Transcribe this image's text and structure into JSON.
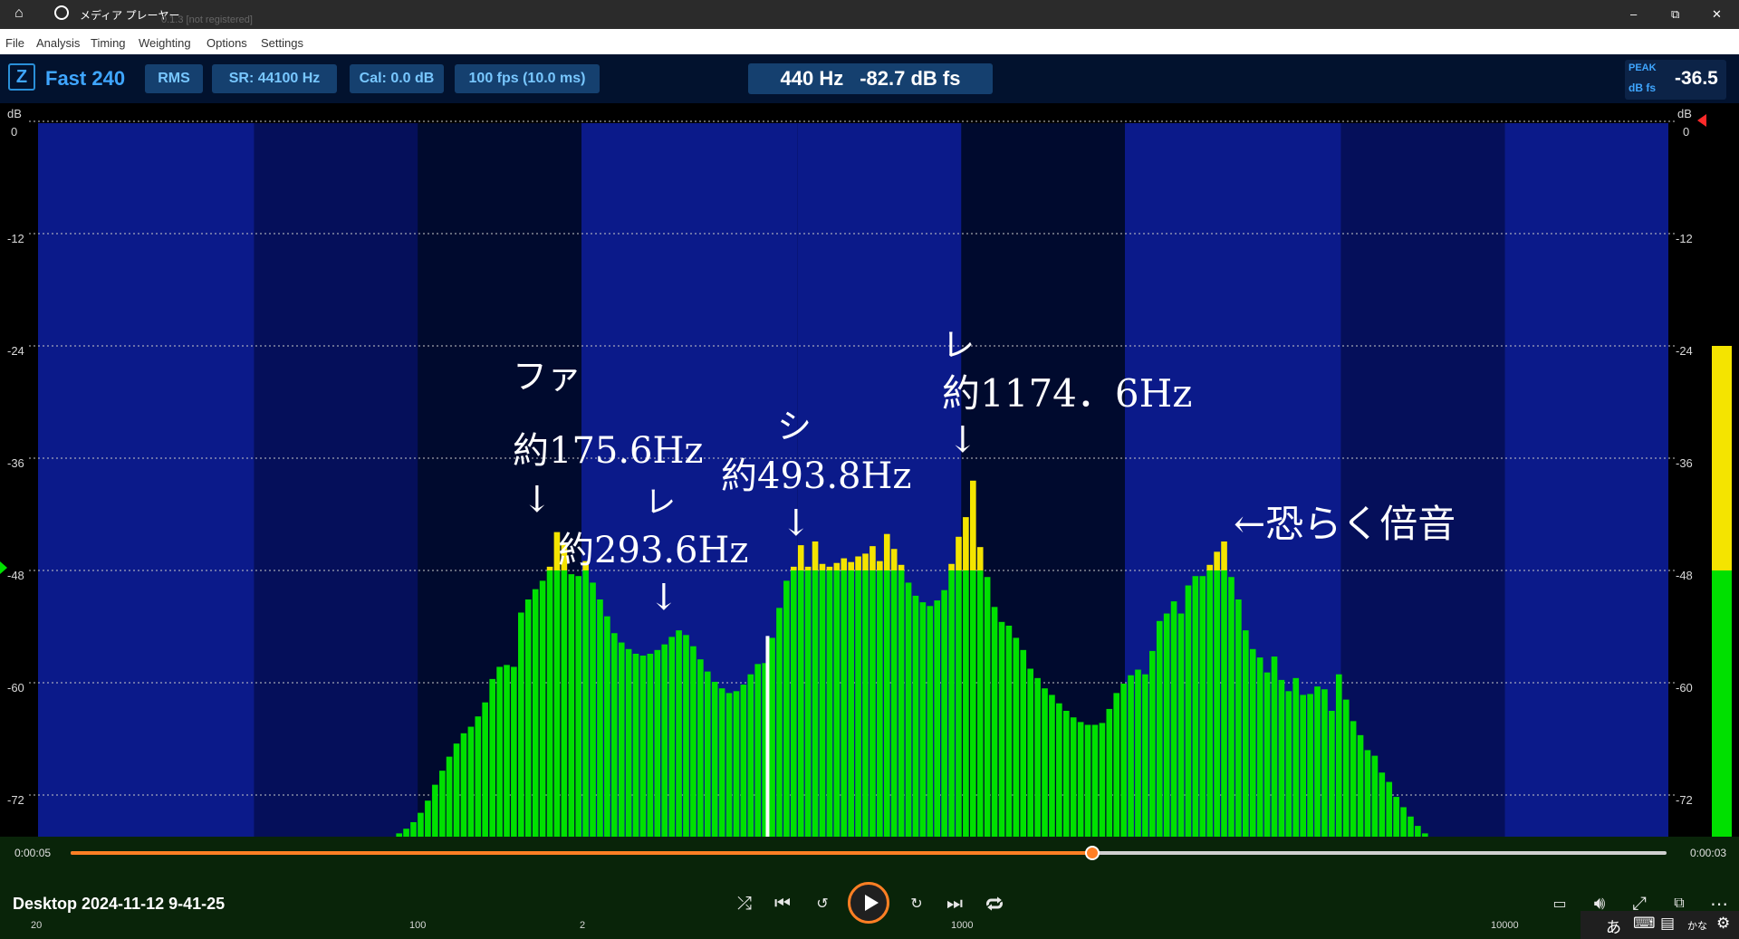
{
  "titlebar": {
    "title": "メディア プレーヤー",
    "behind_title": "0.1.3 [not registered]",
    "minimize": "–",
    "restore": "⧉",
    "close": "✕"
  },
  "menu": [
    "File",
    "Analysis",
    "Timing",
    "Weighting",
    "Options",
    "Settings"
  ],
  "toolbar": {
    "z_label": "Z",
    "mode": "Fast 240",
    "rms": "RMS",
    "sr": "SR: 44100 Hz",
    "cal": "Cal:  0.0 dB",
    "fps": "100 fps (10.0 ms)",
    "readout_freq": "440 Hz",
    "readout_db": "-82.7 dB fs",
    "peak_label": "PEAK",
    "peak_unit": "dB fs",
    "peak_value": "-36.5"
  },
  "axes": {
    "y_unit": "dB",
    "y_ticks": [
      "0",
      "-12",
      "-24",
      "-36",
      "-48",
      "-60",
      "-72"
    ],
    "x_ticks": [
      "20",
      "100",
      "1000",
      "10000"
    ],
    "x_minor_label": "2"
  },
  "annotations": {
    "fa_note": "ファ",
    "fa_freq": "約175.6Hz",
    "re1_note": "レ",
    "re1_freq": "約293.6Hz",
    "si_note": "シ",
    "si_freq": "約493.8Hz",
    "re2_note": "レ",
    "re2_freq": "約1174．6Hz",
    "harmonic": "←恐らく倍音",
    "arrow": "↓"
  },
  "colors": {
    "background_band_a": "#0b1a8a",
    "background_band_b": "#000a2e",
    "bar_green": "#00e000",
    "bar_yellow": "#f4e400",
    "accent_orange": "#ff7f24",
    "readout_text": "#ffffff",
    "button_text": "#78c7ff"
  },
  "player": {
    "elapsed": "0:00:05",
    "remaining": "0:00:03",
    "progress": 0.64,
    "media_title": "Desktop 2024-11-12 9-41-25",
    "icons": [
      "shuffle-icon",
      "previous-icon",
      "rewind-10-icon",
      "play-icon",
      "forward-30-icon",
      "next-icon",
      "repeat-icon",
      "subtitles-icon",
      "volume-icon",
      "fullscreen-icon",
      "miniplayer-icon",
      "more-icon"
    ]
  },
  "peak_meter": {
    "level_db": -24,
    "yellow_from_db": -48
  },
  "taskbar": {
    "ime_mode": "あ",
    "ime_kana": "かな"
  },
  "chart_data": {
    "type": "bar",
    "ylabel": "dB",
    "ylim": [
      -84,
      0
    ],
    "xscale": "log",
    "xlim": [
      20,
      20000
    ],
    "grid": true,
    "bar_color_threshold_db": -48,
    "bands": [
      [
        20.0,
        -82.1
      ],
      [
        20.6,
        -82.1
      ],
      [
        21.3,
        -82.1
      ],
      [
        21.9,
        -82.1
      ],
      [
        22.6,
        -82.1
      ],
      [
        23.3,
        -82.1
      ],
      [
        24.0,
        -82.1
      ],
      [
        24.7,
        -82.1
      ],
      [
        25.5,
        -82.1
      ],
      [
        26.3,
        -82.1
      ],
      [
        27.1,
        -82.1
      ],
      [
        27.9,
        -82.1
      ],
      [
        28.8,
        -82.1
      ],
      [
        29.7,
        -82.1
      ],
      [
        30.6,
        -82.1
      ],
      [
        31.5,
        -82.1
      ],
      [
        32.5,
        -82.1
      ],
      [
        33.5,
        -82.1
      ],
      [
        34.5,
        -82.1
      ],
      [
        35.6,
        -82.1
      ],
      [
        36.7,
        -82.1
      ],
      [
        37.8,
        -82.1
      ],
      [
        39.0,
        -82.1
      ],
      [
        40.2,
        -82.1
      ],
      [
        41.4,
        -82.1
      ],
      [
        42.7,
        -82.1
      ],
      [
        44.0,
        -82.1
      ],
      [
        45.4,
        -82.1
      ],
      [
        46.8,
        -82.1
      ],
      [
        48.2,
        -82.1
      ],
      [
        49.7,
        -82.1
      ],
      [
        51.2,
        -82.1
      ],
      [
        52.8,
        -82.1
      ],
      [
        54.4,
        -82.1
      ],
      [
        56.1,
        -82.1
      ],
      [
        57.8,
        -82.1
      ],
      [
        59.6,
        -82.1
      ],
      [
        61.5,
        -82.1
      ],
      [
        63.4,
        -82.1
      ],
      [
        65.3,
        -82.1
      ],
      [
        67.3,
        -82.1
      ],
      [
        69.4,
        -80.9
      ],
      [
        71.5,
        -80.3
      ],
      [
        73.7,
        -79.7
      ],
      [
        76.0,
        -79.1
      ],
      [
        78.3,
        -78.5
      ],
      [
        80.8,
        -77.9
      ],
      [
        83.2,
        -77.4
      ],
      [
        85.8,
        -76.9
      ],
      [
        88.5,
        -76.5
      ],
      [
        91.2,
        -76.1
      ],
      [
        94.0,
        -75.6
      ],
      [
        96.9,
        -74.9
      ],
      [
        99.9,
        -73.9
      ],
      [
        103.0,
        -72.6
      ],
      [
        106.2,
        -70.9
      ],
      [
        109.5,
        -69.4
      ],
      [
        112.8,
        -67.9
      ],
      [
        116.3,
        -66.5
      ],
      [
        119.9,
        -65.4
      ],
      [
        123.6,
        -64.7
      ],
      [
        127.4,
        -63.6
      ],
      [
        131.3,
        -62.1
      ],
      [
        135.4,
        -59.6
      ],
      [
        139.6,
        -58.3
      ],
      [
        143.9,
        -58.1
      ],
      [
        148.3,
        -58.3
      ],
      [
        152.9,
        -52.5
      ],
      [
        157.6,
        -51.1
      ],
      [
        162.5,
        -50.0
      ],
      [
        167.5,
        -49.1
      ],
      [
        172.7,
        -47.6
      ],
      [
        178.0,
        -43.9
      ],
      [
        183.5,
        -45.0
      ],
      [
        189.2,
        -48.4
      ],
      [
        195.0,
        -48.6
      ],
      [
        201.0,
        -47.0
      ],
      [
        207.2,
        -49.3
      ],
      [
        213.6,
        -51.1
      ],
      [
        220.2,
        -52.9
      ],
      [
        227.0,
        -54.7
      ],
      [
        234.0,
        -55.7
      ],
      [
        241.2,
        -56.4
      ],
      [
        248.6,
        -56.9
      ],
      [
        256.3,
        -57.1
      ],
      [
        264.2,
        -56.9
      ],
      [
        272.4,
        -56.5
      ],
      [
        280.8,
        -55.9
      ],
      [
        289.5,
        -55.1
      ],
      [
        298.4,
        -54.4
      ],
      [
        307.6,
        -54.9
      ],
      [
        317.1,
        -56.1
      ],
      [
        326.9,
        -57.5
      ],
      [
        337.0,
        -58.8
      ],
      [
        347.4,
        -59.9
      ],
      [
        358.1,
        -60.6
      ],
      [
        369.2,
        -61.1
      ],
      [
        380.6,
        -60.9
      ],
      [
        392.3,
        -60.2
      ],
      [
        404.4,
        -59.1
      ],
      [
        416.9,
        -58.0
      ],
      [
        429.8,
        -57.9
      ],
      [
        443.0,
        -55.2
      ],
      [
        456.7,
        -52.0
      ],
      [
        470.8,
        -49.1
      ],
      [
        485.3,
        -47.6
      ],
      [
        500.3,
        -45.3
      ],
      [
        515.7,
        -47.6
      ],
      [
        531.6,
        -44.9
      ],
      [
        548.0,
        -47.3
      ],
      [
        565.0,
        -47.6
      ],
      [
        582.4,
        -47.2
      ],
      [
        600.4,
        -46.7
      ],
      [
        618.9,
        -47.1
      ],
      [
        638.0,
        -46.5
      ],
      [
        657.7,
        -46.2
      ],
      [
        678.0,
        -45.4
      ],
      [
        698.9,
        -47.0
      ],
      [
        720.5,
        -44.1
      ],
      [
        742.7,
        -45.7
      ],
      [
        765.6,
        -47.4
      ],
      [
        789.3,
        -49.3
      ],
      [
        813.6,
        -50.7
      ],
      [
        838.8,
        -51.4
      ],
      [
        864.6,
        -51.8
      ],
      [
        891.3,
        -51.2
      ],
      [
        918.8,
        -50.1
      ],
      [
        947.2,
        -47.3
      ],
      [
        976.4,
        -44.4
      ],
      [
        1006.5,
        -42.3
      ],
      [
        1037.6,
        -38.4
      ],
      [
        1069.6,
        -45.5
      ],
      [
        1102.6,
        -48.7
      ],
      [
        1136.7,
        -51.9
      ],
      [
        1171.8,
        -53.5
      ],
      [
        1207.9,
        -53.9
      ],
      [
        1245.2,
        -55.2
      ],
      [
        1283.6,
        -56.5
      ],
      [
        1323.2,
        -58.5
      ],
      [
        1364.1,
        -59.5
      ],
      [
        1406.2,
        -60.6
      ],
      [
        1449.6,
        -61.3
      ],
      [
        1494.3,
        -62.2
      ],
      [
        1540.4,
        -63.0
      ],
      [
        1588.0,
        -63.7
      ],
      [
        1637.0,
        -64.2
      ],
      [
        1687.5,
        -64.5
      ],
      [
        1739.6,
        -64.5
      ],
      [
        1793.3,
        -64.3
      ],
      [
        1848.6,
        -62.8
      ],
      [
        1905.7,
        -61.1
      ],
      [
        1964.5,
        -60.1
      ],
      [
        2025.1,
        -59.2
      ],
      [
        2087.6,
        -58.6
      ],
      [
        2152.1,
        -59.1
      ],
      [
        2218.5,
        -56.6
      ],
      [
        2287.0,
        -53.4
      ],
      [
        2357.6,
        -52.6
      ],
      [
        2430.3,
        -51.3
      ],
      [
        2505.3,
        -52.6
      ],
      [
        2582.7,
        -49.6
      ],
      [
        2662.4,
        -48.6
      ],
      [
        2744.6,
        -48.6
      ],
      [
        2829.3,
        -47.4
      ],
      [
        2916.6,
        -46.0
      ],
      [
        3006.6,
        -44.9
      ],
      [
        3099.4,
        -48.7
      ],
      [
        3195.1,
        -51.1
      ],
      [
        3293.7,
        -54.4
      ],
      [
        3395.4,
        -56.4
      ],
      [
        3500.2,
        -57.3
      ],
      [
        3608.2,
        -58.9
      ],
      [
        3719.6,
        -57.2
      ],
      [
        3834.4,
        -59.7
      ],
      [
        3952.7,
        -60.9
      ],
      [
        4074.7,
        -59.5
      ],
      [
        4200.5,
        -61.3
      ],
      [
        4330.1,
        -61.2
      ],
      [
        4463.8,
        -60.4
      ],
      [
        4601.5,
        -60.7
      ],
      [
        4743.5,
        -63.0
      ],
      [
        4889.9,
        -59.1
      ],
      [
        5040.9,
        -61.8
      ],
      [
        5196.5,
        -64.1
      ],
      [
        5356.9,
        -65.6
      ],
      [
        5522.2,
        -67.2
      ],
      [
        5692.6,
        -67.8
      ],
      [
        5868.3,
        -69.6
      ],
      [
        6049.4,
        -70.6
      ],
      [
        6236.1,
        -72.2
      ],
      [
        6428.6,
        -73.3
      ],
      [
        6627.0,
        -74.3
      ],
      [
        6831.5,
        -75.3
      ],
      [
        7042.4,
        -76.1
      ],
      [
        7259.7,
        -76.8
      ],
      [
        7483.8,
        -77.4
      ],
      [
        7714.8,
        -77.8
      ],
      [
        7952.9,
        -78.3
      ],
      [
        8198.4,
        -78.8
      ],
      [
        8451.4,
        -79.2
      ],
      [
        8712.2,
        -79.6
      ],
      [
        8981.1,
        -79.9
      ],
      [
        9258.3,
        -80.3
      ],
      [
        9544.1,
        -80.6
      ],
      [
        9838.6,
        -80.9
      ],
      [
        10142.3,
        -81.2
      ],
      [
        10455.3,
        -81.5
      ],
      [
        10778.0,
        -81.8
      ],
      [
        11110.7,
        -82.0
      ],
      [
        11453.6,
        -82.3
      ],
      [
        11807.1,
        -82.5
      ],
      [
        12171.5,
        -82.7
      ],
      [
        12547.2,
        -82.9
      ],
      [
        12934.4,
        -83.1
      ],
      [
        13333.6,
        -83.2
      ],
      [
        13745.2,
        -83.4
      ],
      [
        14169.4,
        -83.5
      ],
      [
        14606.7,
        -83.6
      ],
      [
        15057.6,
        -83.7
      ],
      [
        15522.3,
        -83.8
      ],
      [
        16001.4,
        -83.9
      ],
      [
        16495.3,
        -83.9
      ],
      [
        17004.4,
        -84.0
      ],
      [
        17529.3,
        -84.0
      ],
      [
        18070.3,
        -84.0
      ],
      [
        18628.0,
        -83.9
      ],
      [
        19203.0,
        -83.9
      ],
      [
        19795.7,
        -83.8
      ],
      [
        20406.7,
        -83.7
      ],
      [
        21036.5,
        -83.6
      ]
    ]
  }
}
